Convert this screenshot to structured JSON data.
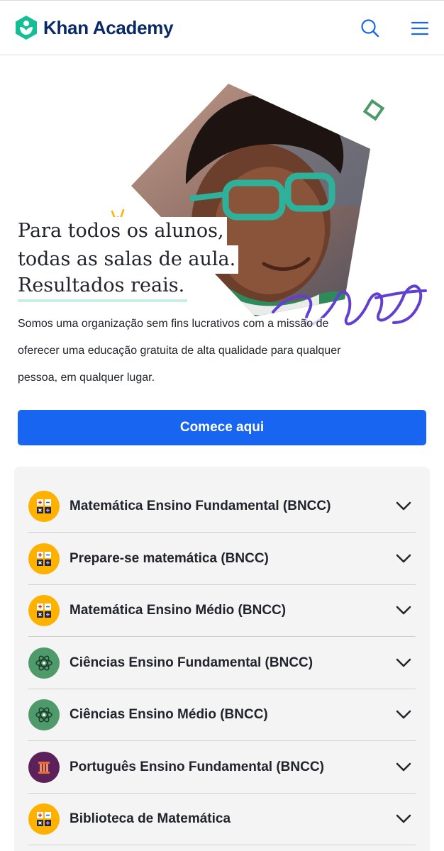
{
  "header": {
    "logo_text": "Khan Academy",
    "logo_icon": "khan-academy-leaf-hexagon-icon",
    "search_icon": "search-icon",
    "menu_icon": "hamburger-menu-icon",
    "brand_color": "#14bf96",
    "accent_color": "#1865f2"
  },
  "hero": {
    "headline_lines": [
      "Para todos os alunos,",
      "todas as salas de aula.",
      "Resultados reais."
    ],
    "mission": "Somos uma organização sem fins lucrativos com a missão de oferecer uma educação gratuita de alta qualidade para qualquer pessoa, em qualquer lugar.",
    "cta_label": "Comece aqui",
    "image": "photo-of-smiling-student-with-green-glasses"
  },
  "courses": [
    {
      "label": "Matemática Ensino Fundamental (BNCC)",
      "icon": "math-operators-icon",
      "color": "#ffb100"
    },
    {
      "label": "Prepare-se matemática (BNCC)",
      "icon": "math-operators-icon",
      "color": "#ffb100"
    },
    {
      "label": "Matemática Ensino Médio (BNCC)",
      "icon": "math-operators-icon",
      "color": "#ffb100"
    },
    {
      "label": "Ciências Ensino Fundamental (BNCC)",
      "icon": "atom-icon",
      "color": "#4e9a6b"
    },
    {
      "label": "Ciências Ensino Médio (BNCC)",
      "icon": "atom-icon",
      "color": "#4e9a6b"
    },
    {
      "label": "Português Ensino Fundamental (BNCC)",
      "icon": "column-pillar-icon",
      "color": "#5b2158"
    },
    {
      "label": "Biblioteca de Matemática",
      "icon": "math-operators-icon",
      "color": "#ffb100"
    }
  ],
  "expand_icon": "chevron-down-icon"
}
